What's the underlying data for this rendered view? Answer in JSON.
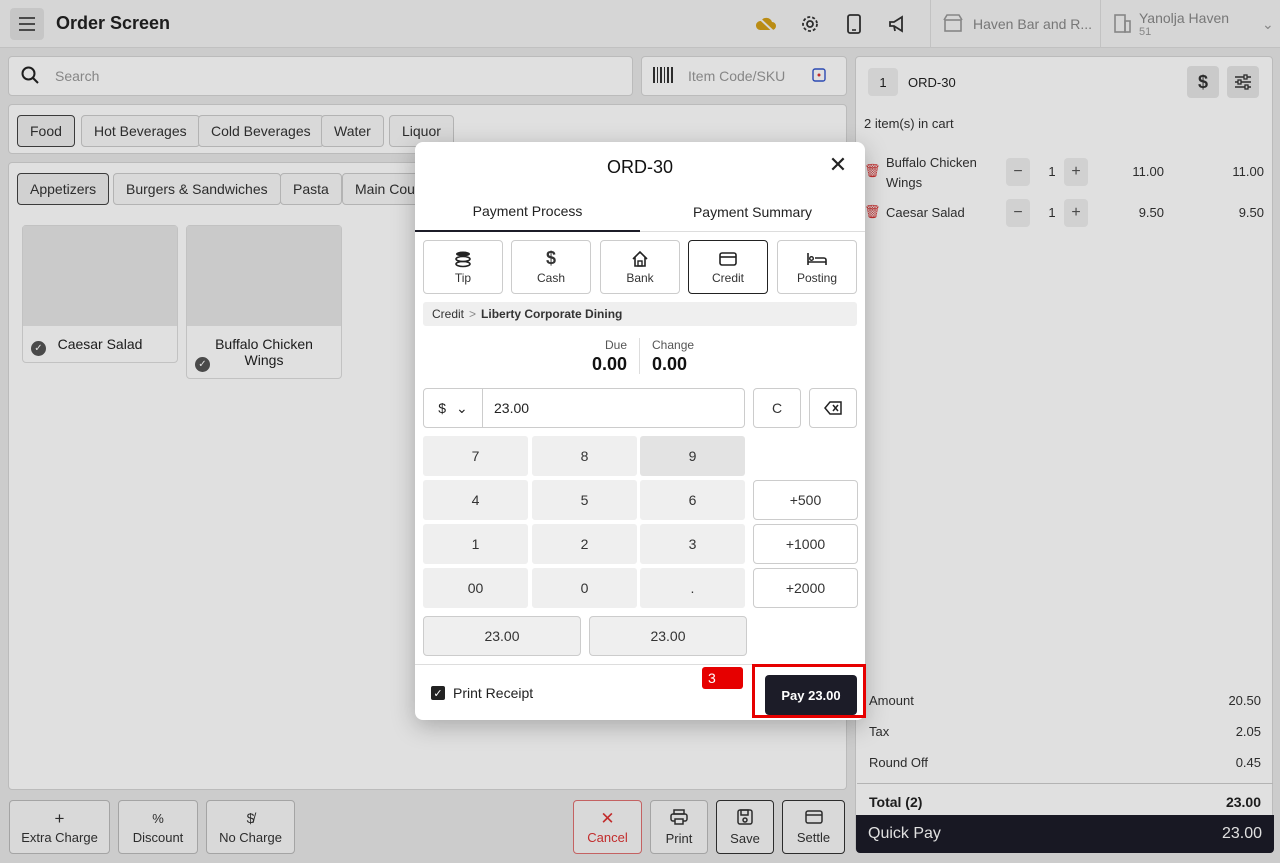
{
  "header": {
    "title": "Order Screen",
    "store": "Haven Bar and R...",
    "user_name": "Yanolja Haven",
    "user_id": "51"
  },
  "search": {
    "placeholder": "Search",
    "sku_placeholder": "Item Code/SKU"
  },
  "categories": [
    "Food",
    "Hot Beverages",
    "Cold Beverages",
    "Water",
    "Liquor"
  ],
  "subcategories": [
    "Appetizers",
    "Burgers & Sandwiches",
    "Pasta",
    "Main Cours"
  ],
  "products": [
    "Caesar Salad",
    "Buffalo Chicken Wings"
  ],
  "bottom_actions": {
    "extra_charge": "Extra Charge",
    "discount": "Discount",
    "no_charge": "No Charge",
    "cancel": "Cancel",
    "print": "Print",
    "save": "Save",
    "settle": "Settle"
  },
  "cart": {
    "seq": "1",
    "order": "ORD-30",
    "count_label": "2 item(s) in cart",
    "items": [
      {
        "name": "Buffalo Chicken Wings",
        "qty": "1",
        "price": "11.00",
        "total": "11.00"
      },
      {
        "name": "Caesar Salad",
        "qty": "1",
        "price": "9.50",
        "total": "9.50"
      }
    ],
    "summary": {
      "amount_label": "Amount",
      "amount": "20.50",
      "tax_label": "Tax",
      "tax": "2.05",
      "round_label": "Round Off",
      "round": "0.45",
      "total_label": "Total (2)",
      "total": "23.00"
    },
    "quick_pay_label": "Quick Pay",
    "quick_pay_amount": "23.00"
  },
  "dialog": {
    "title": "ORD-30",
    "tabs": [
      "Payment Process",
      "Payment Summary"
    ],
    "methods": [
      "Tip",
      "Cash",
      "Bank",
      "Credit",
      "Posting"
    ],
    "crumb_root": "Credit",
    "crumb_leaf": "Liberty Corporate Dining",
    "due_label": "Due",
    "due": "0.00",
    "change_label": "Change",
    "change": "0.00",
    "currency": "$",
    "amount": "23.00",
    "clear": "C",
    "keys": [
      "7",
      "8",
      "9",
      "4",
      "5",
      "6",
      "1",
      "2",
      "3",
      "00",
      "0",
      "."
    ],
    "plus": [
      "+500",
      "+1000",
      "+2000"
    ],
    "quick_amounts": [
      "23.00",
      "23.00"
    ],
    "print_receipt": "Print Receipt",
    "step_badge": "3",
    "pay_button": "Pay 23.00"
  },
  "colors": {
    "accent_dark": "#1c1c28",
    "highlight": "#e60000",
    "delete": "#dd3333",
    "cloud": "#d4a017"
  }
}
